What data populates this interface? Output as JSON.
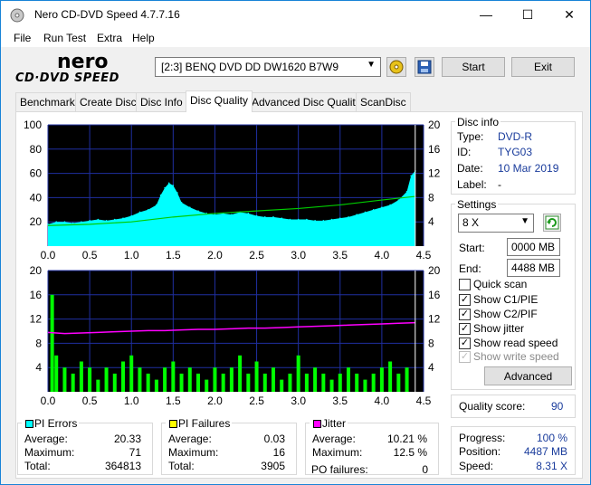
{
  "window": {
    "title": "Nero CD-DVD Speed 4.7.7.16"
  },
  "menu": [
    "File",
    "Run Test",
    "Extra",
    "Help"
  ],
  "logo": {
    "line1": "nero",
    "line2": "CD·DVD SPEED"
  },
  "drive": {
    "selected": "[2:3]   BENQ DVD DD DW1620 B7W9"
  },
  "toolbar": {
    "start_label": "Start",
    "exit_label": "Exit"
  },
  "tabs": [
    "Benchmark",
    "Create Disc",
    "Disc Info",
    "Disc Quality",
    "Advanced Disc Quality",
    "ScanDisc"
  ],
  "active_tab": "Disc Quality",
  "disc_info": {
    "title": "Disc info",
    "type_label": "Type:",
    "type": "DVD-R",
    "id_label": "ID:",
    "id": "TYG03",
    "date_label": "Date:",
    "date": "10 Mar 2019",
    "label_label": "Label:",
    "label": "-"
  },
  "settings": {
    "title": "Settings",
    "speed": "8 X",
    "start_label": "Start:",
    "start": "0000 MB",
    "end_label": "End:",
    "end": "4488 MB",
    "quick_scan": "Quick scan",
    "show_c1pie": "Show C1/PIE",
    "show_c2pif": "Show C2/PIF",
    "show_jitter": "Show jitter",
    "show_read_speed": "Show read speed",
    "show_write_speed": "Show write speed",
    "advanced_label": "Advanced"
  },
  "quality": {
    "label": "Quality score:",
    "value": "90"
  },
  "progress": {
    "progress_label": "Progress:",
    "progress": "100 %",
    "position_label": "Position:",
    "position": "4487 MB",
    "speed_label": "Speed:",
    "speed": "8.31 X"
  },
  "pi_errors": {
    "title": "PI Errors",
    "avg_label": "Average:",
    "avg": "20.33",
    "max_label": "Maximum:",
    "max": "71",
    "total_label": "Total:",
    "total": "364813"
  },
  "pi_failures": {
    "title": "PI Failures",
    "avg_label": "Average:",
    "avg": "0.03",
    "max_label": "Maximum:",
    "max": "16",
    "total_label": "Total:",
    "total": "3905"
  },
  "jitter": {
    "title": "Jitter",
    "avg_label": "Average:",
    "avg": "10.21 %",
    "max_label": "Maximum:",
    "max": "12.5 %",
    "po_label": "PO failures:",
    "po": "0"
  },
  "colors": {
    "pi_errors": "#00ffff",
    "pi_failures": "#ffff00",
    "jitter": "#ff00ff",
    "read_speed": "#00cc00",
    "plot_bg": "#000000",
    "grid": "#1f2fa0"
  },
  "chart_data": [
    {
      "type": "area",
      "x_ticks": [
        "0.0",
        "0.5",
        "1.0",
        "1.5",
        "2.0",
        "2.5",
        "3.0",
        "3.5",
        "4.0",
        "4.5"
      ],
      "y_left_ticks": [
        "100",
        "80",
        "60",
        "40",
        "20"
      ],
      "y_right_ticks": [
        "20",
        "16",
        "12",
        "8",
        "4"
      ],
      "xlim": [
        0,
        4.5
      ],
      "ylim": [
        0,
        100
      ],
      "y2lim": [
        0,
        20
      ],
      "series": [
        {
          "color": "#00ffff",
          "x": [
            0.0,
            0.1,
            0.2,
            0.3,
            0.4,
            0.5,
            0.6,
            0.7,
            0.8,
            0.9,
            1.0,
            1.1,
            1.2,
            1.3,
            1.35,
            1.4,
            1.45,
            1.5,
            1.55,
            1.6,
            1.7,
            1.8,
            1.9,
            2.0,
            2.1,
            2.2,
            2.3,
            2.4,
            2.5,
            2.6,
            2.7,
            2.8,
            2.9,
            3.0,
            3.1,
            3.2,
            3.3,
            3.4,
            3.5,
            3.6,
            3.7,
            3.8,
            3.9,
            4.0,
            4.1,
            4.2,
            4.3,
            4.35,
            4.4
          ],
          "values": [
            18,
            20,
            20,
            19,
            20,
            21,
            22,
            21,
            22,
            23,
            25,
            28,
            30,
            34,
            42,
            48,
            52,
            50,
            44,
            36,
            32,
            29,
            27,
            26,
            27,
            26,
            28,
            27,
            25,
            24,
            24,
            23,
            22,
            22,
            22,
            21,
            21,
            22,
            23,
            24,
            26,
            28,
            30,
            32,
            34,
            38,
            45,
            58,
            62
          ]
        },
        {
          "color": "#00cc00",
          "x": [
            0.0,
            0.5,
            1.0,
            1.5,
            2.0,
            2.5,
            3.0,
            3.5,
            4.0,
            4.4
          ],
          "values": [
            3.4,
            3.6,
            4.0,
            4.8,
            5.4,
            5.8,
            6.2,
            6.8,
            7.6,
            8.2
          ]
        }
      ]
    },
    {
      "type": "bar",
      "x_ticks": [
        "0.0",
        "0.5",
        "1.0",
        "1.5",
        "2.0",
        "2.5",
        "3.0",
        "3.5",
        "4.0",
        "4.5"
      ],
      "y_left_ticks": [
        "20",
        "16",
        "12",
        "8",
        "4"
      ],
      "y_right_ticks": [
        "20",
        "16",
        "12",
        "8",
        "4"
      ],
      "xlim": [
        0,
        4.5
      ],
      "ylim": [
        0,
        20
      ],
      "y2lim": [
        0,
        20
      ],
      "series": [
        {
          "color": "#00ff00",
          "x": [
            0.05,
            0.1,
            0.2,
            0.3,
            0.4,
            0.5,
            0.6,
            0.7,
            0.8,
            0.9,
            1.0,
            1.1,
            1.2,
            1.3,
            1.4,
            1.5,
            1.6,
            1.7,
            1.8,
            1.9,
            2.0,
            2.1,
            2.2,
            2.3,
            2.4,
            2.5,
            2.6,
            2.7,
            2.8,
            2.9,
            3.0,
            3.1,
            3.2,
            3.3,
            3.4,
            3.5,
            3.6,
            3.7,
            3.8,
            3.9,
            4.0,
            4.1,
            4.2,
            4.3
          ],
          "values": [
            16,
            6,
            4,
            3,
            5,
            4,
            2,
            4,
            3,
            5,
            6,
            4,
            3,
            2,
            4,
            5,
            3,
            4,
            3,
            2,
            4,
            3,
            4,
            6,
            3,
            5,
            3,
            4,
            2,
            3,
            6,
            3,
            4,
            3,
            2,
            3,
            4,
            3,
            2,
            3,
            4,
            5,
            3,
            4
          ]
        },
        {
          "color": "#ff00ff",
          "x": [
            0.0,
            0.2,
            0.4,
            0.6,
            0.8,
            1.0,
            1.2,
            1.4,
            1.6,
            1.8,
            2.0,
            2.2,
            2.4,
            2.6,
            2.8,
            3.0,
            3.2,
            3.4,
            3.6,
            3.8,
            4.0,
            4.2,
            4.4
          ],
          "values": [
            9.8,
            9.6,
            9.7,
            9.8,
            9.9,
            10.0,
            10.1,
            10.1,
            10.2,
            10.3,
            10.3,
            10.4,
            10.5,
            10.5,
            10.6,
            10.7,
            10.8,
            10.9,
            11.0,
            11.1,
            11.2,
            11.3,
            11.4
          ]
        }
      ]
    }
  ]
}
